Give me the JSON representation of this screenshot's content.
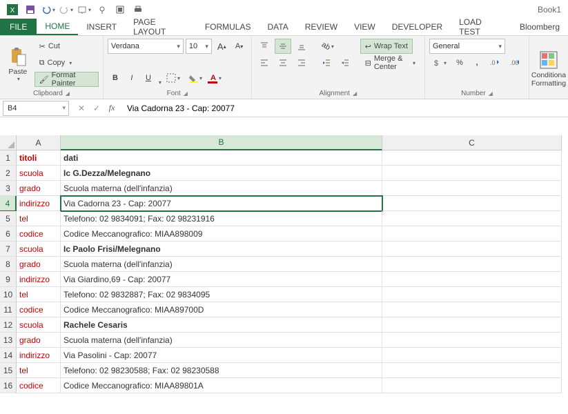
{
  "title_book": "Book1",
  "tabs": [
    "FILE",
    "HOME",
    "INSERT",
    "PAGE LAYOUT",
    "FORMULAS",
    "DATA",
    "REVIEW",
    "VIEW",
    "DEVELOPER",
    "LOAD TEST",
    "Bloomberg"
  ],
  "active_tab": "HOME",
  "clipboard": {
    "paste": "Paste",
    "cut": "Cut",
    "copy": "Copy",
    "painter": "Format Painter",
    "label": "Clipboard"
  },
  "font": {
    "name": "Verdana",
    "size": "10",
    "label": "Font",
    "bold": "B",
    "italic": "I",
    "underline": "U"
  },
  "alignment": {
    "wrap": "Wrap Text",
    "merge": "Merge & Center",
    "label": "Alignment"
  },
  "number": {
    "format": "General",
    "label": "Number",
    "percent": "%"
  },
  "styles": {
    "cond": "Conditiona",
    "cond2": "Formatting"
  },
  "namebox": "B4",
  "formula": "Via Cadorna 23 - Cap: 20077",
  "fx": "fx",
  "cols": [
    "A",
    "B",
    "C"
  ],
  "rows": [
    {
      "n": "1",
      "a": "titoli",
      "b": "dati",
      "astyle": "redbold",
      "bstyle": "bold"
    },
    {
      "n": "2",
      "a": "scuola",
      "b": "Ic G.Dezza/Melegnano",
      "astyle": "red",
      "bstyle": "bold"
    },
    {
      "n": "3",
      "a": "grado",
      "b": "Scuola materna (dell'infanzia)",
      "astyle": "red",
      "bstyle": ""
    },
    {
      "n": "4",
      "a": "indirizzo",
      "b": "Via Cadorna 23 - Cap: 20077",
      "astyle": "red",
      "bstyle": ""
    },
    {
      "n": "5",
      "a": "tel",
      "b": "Telefono: 02 9834091; Fax: 02 98231916",
      "astyle": "red",
      "bstyle": ""
    },
    {
      "n": "6",
      "a": "codice",
      "b": "Codice Meccanografico: MIAA898009",
      "astyle": "red",
      "bstyle": ""
    },
    {
      "n": "7",
      "a": "scuola",
      "b": "Ic Paolo Frisi/Melegnano",
      "astyle": "red",
      "bstyle": "bold"
    },
    {
      "n": "8",
      "a": "grado",
      "b": "Scuola materna (dell'infanzia)",
      "astyle": "red",
      "bstyle": ""
    },
    {
      "n": "9",
      "a": "indirizzo",
      "b": "Via Giardino,69 - Cap: 20077",
      "astyle": "red",
      "bstyle": ""
    },
    {
      "n": "10",
      "a": "tel",
      "b": "Telefono: 02 9832887; Fax: 02 9834095",
      "astyle": "red",
      "bstyle": ""
    },
    {
      "n": "11",
      "a": "codice",
      "b": "Codice Meccanografico: MIAA89700D",
      "astyle": "red",
      "bstyle": ""
    },
    {
      "n": "12",
      "a": "scuola",
      "b": "Rachele Cesaris",
      "astyle": "red",
      "bstyle": "bold"
    },
    {
      "n": "13",
      "a": "grado",
      "b": "Scuola materna (dell'infanzia)",
      "astyle": "red",
      "bstyle": ""
    },
    {
      "n": "14",
      "a": "indirizzo",
      "b": "Via Pasolini - Cap: 20077",
      "astyle": "red",
      "bstyle": ""
    },
    {
      "n": "15",
      "a": "tel",
      "b": "Telefono: 02 98230588; Fax: 02 98230588",
      "astyle": "red",
      "bstyle": ""
    },
    {
      "n": "16",
      "a": "codice",
      "b": "Codice Meccanografico: MIAA89801A",
      "astyle": "red",
      "bstyle": ""
    }
  ],
  "selected_row": "4",
  "selected_col": "B"
}
